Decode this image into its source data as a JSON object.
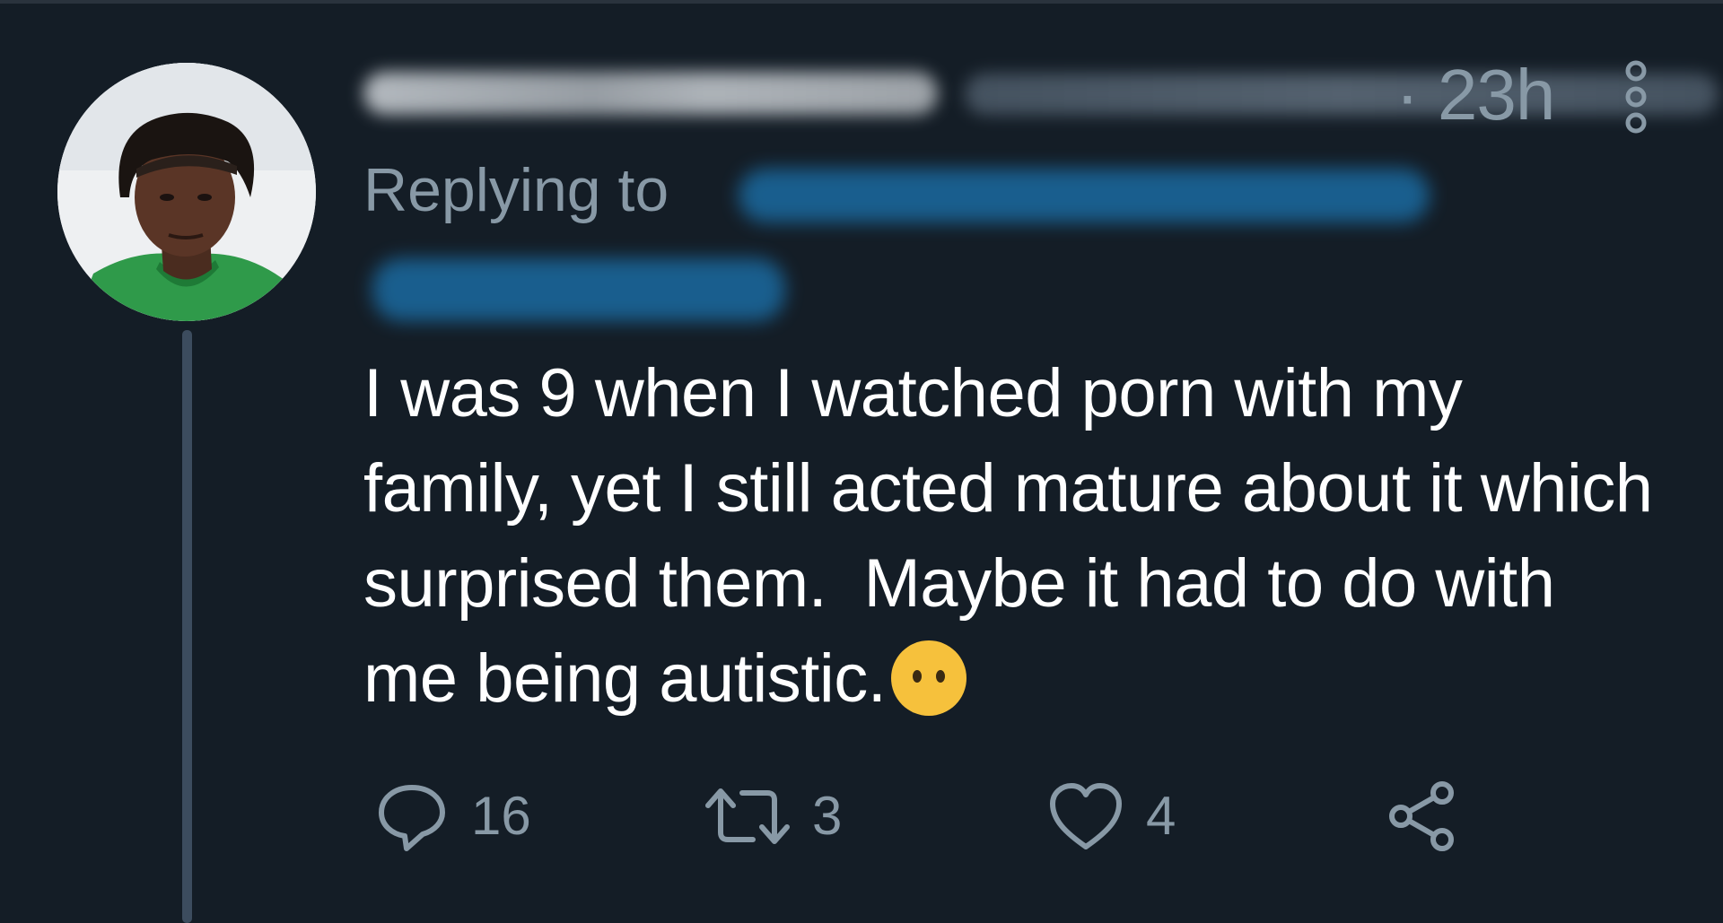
{
  "tweet": {
    "timestamp": "· 23h",
    "replying_label": "Replying to",
    "text": "I was 9 when I watched porn with my family, yet I still acted mature about it which surprised them.  Maybe it had to do with me being autistic.",
    "emoji": "face-without-mouth"
  },
  "actions": {
    "reply": {
      "icon": "reply-icon",
      "count": "16"
    },
    "retweet": {
      "icon": "retweet-icon",
      "count": "3"
    },
    "like": {
      "icon": "heart-icon",
      "count": "4"
    },
    "share": {
      "icon": "share-icon"
    }
  },
  "colors": {
    "background": "#141d26",
    "muted_text": "#8899a6",
    "thread_line": "#3c4c5e",
    "mention_blue": "#1b6fa8",
    "emoji_yellow": "#f6c13c"
  }
}
